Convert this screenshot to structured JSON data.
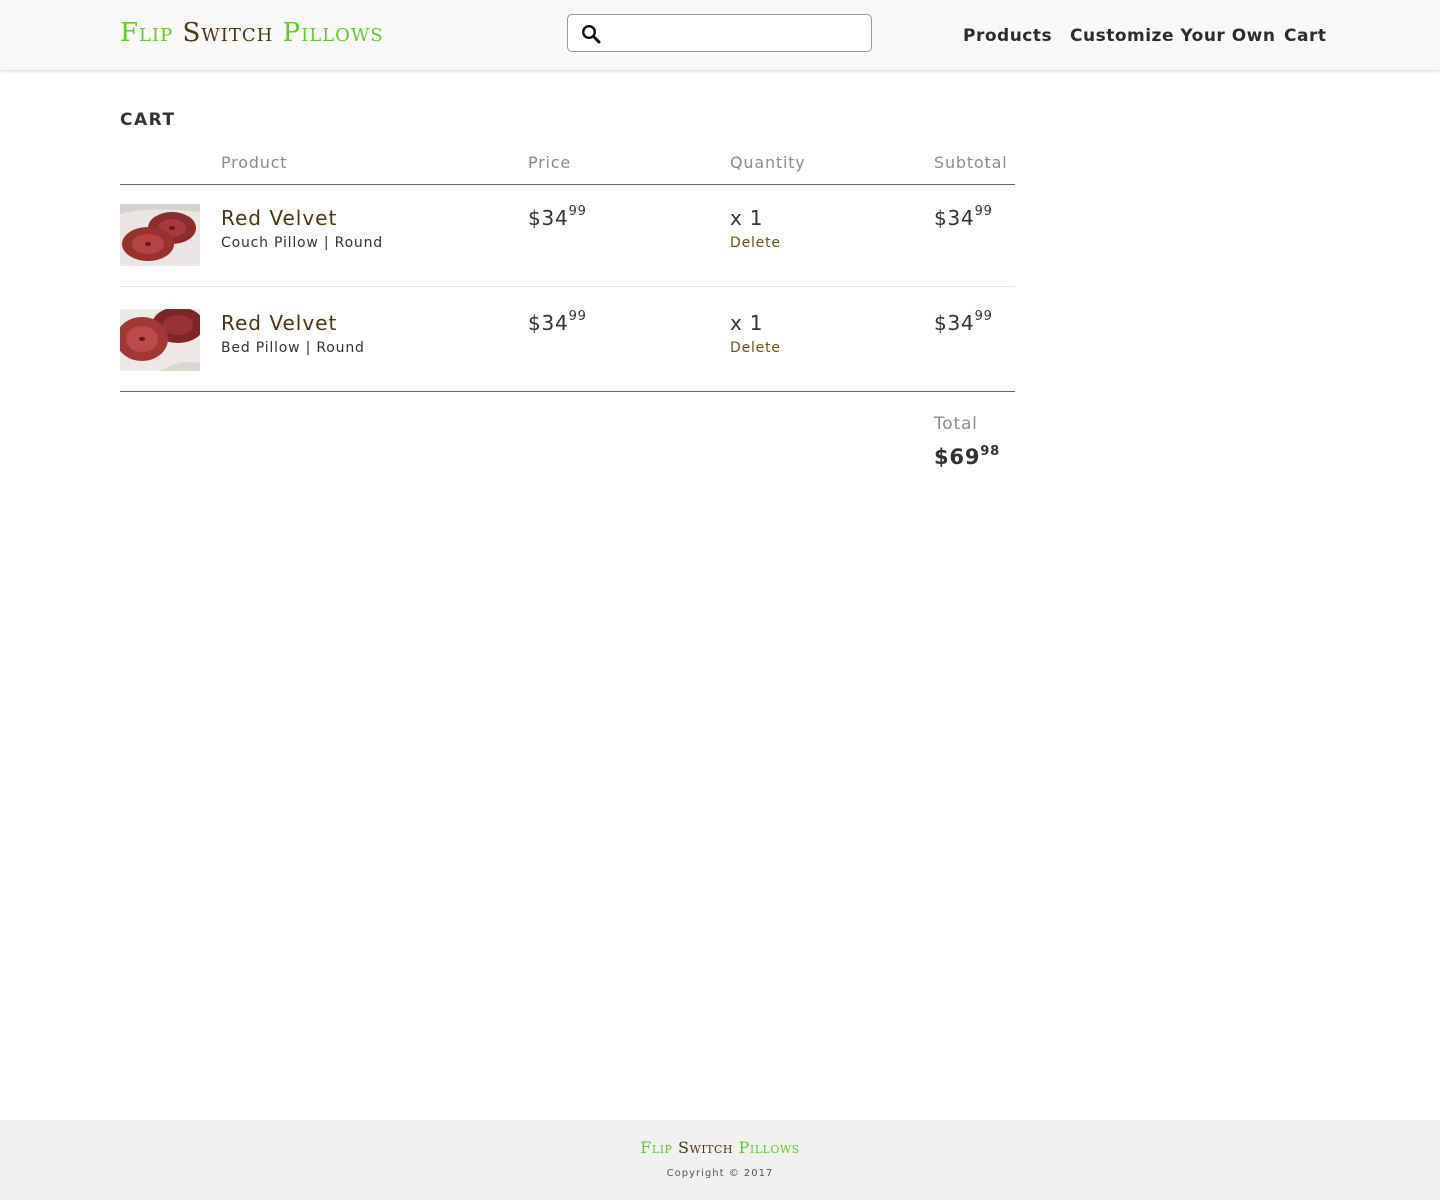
{
  "header": {
    "logo": {
      "part1": "Flip",
      "part2": "Switch",
      "part3": "Pillows"
    },
    "search": {
      "value": "",
      "placeholder": ""
    },
    "nav": {
      "products": "Products",
      "customize": "Customize Your Own",
      "cart": "Cart"
    }
  },
  "cart": {
    "title": "CART",
    "columns": {
      "product": "Product",
      "price": "Price",
      "quantity": "Quantity",
      "subtotal": "Subtotal"
    },
    "items": [
      {
        "name": "Red Velvet",
        "desc": "Couch Pillow | Round",
        "price_whole": "$34",
        "price_cents": "99",
        "qty": "x 1",
        "delete": "Delete",
        "subtotal_whole": "$34",
        "subtotal_cents": "99"
      },
      {
        "name": "Red Velvet",
        "desc": "Bed Pillow | Round",
        "price_whole": "$34",
        "price_cents": "99",
        "qty": "x 1",
        "delete": "Delete",
        "subtotal_whole": "$34",
        "subtotal_cents": "99"
      }
    ],
    "total_label": "Total",
    "total_whole": "$69",
    "total_cents": "98"
  },
  "footer": {
    "logo": {
      "part1": "Flip",
      "part2": "Switch",
      "part3": "Pillows"
    },
    "copyright": "Copyright © 2017"
  },
  "colors": {
    "logo_green": "#5fcc29",
    "logo_brown": "#4a3810",
    "link_brown": "#6b5418"
  }
}
